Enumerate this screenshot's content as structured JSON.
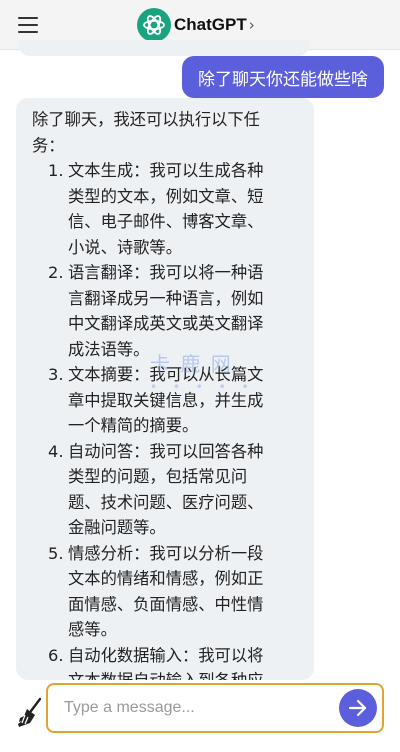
{
  "header": {
    "title": "ChatGPT",
    "title_chevron": "›"
  },
  "conversation": {
    "user_message": "除了聊天你还能做些啥",
    "assistant_message": {
      "intro_lines": [
        "除了聊天，我还可以执行以下任",
        "务："
      ],
      "tasks": [
        {
          "num": "1.",
          "lines": [
            "文本生成：我可以生成各种",
            "类型的文本，例如文章、短",
            "信、电子邮件、博客文章、",
            "小说、诗歌等。"
          ]
        },
        {
          "num": "2.",
          "lines": [
            "语言翻译：我可以将一种语",
            "言翻译成另一种语言，例如",
            "中文翻译成英文或英文翻译",
            "成法语等。"
          ]
        },
        {
          "num": "3.",
          "lines": [
            "文本摘要：我可以从长篇文",
            "章中提取关键信息，并生成",
            "一个精简的摘要。"
          ]
        },
        {
          "num": "4.",
          "lines": [
            "自动问答：我可以回答各种",
            "类型的问题，包括常见问",
            "题、技术问题、医疗问题、",
            "金融问题等。"
          ]
        },
        {
          "num": "5.",
          "lines": [
            "情感分析：我可以分析一段",
            "文本的情绪和情感，例如正",
            "面情感、负面情感、中性情",
            "感等。"
          ]
        },
        {
          "num": "6.",
          "lines": [
            "自动化数据输入：我可以将",
            "文本数据自动输入到各种应"
          ]
        }
      ]
    }
  },
  "watermark": {
    "text": "卡 鹿 网",
    "dots": "• • • • •"
  },
  "composer": {
    "placeholder": "Type a message...",
    "value": ""
  },
  "colors": {
    "accent": "#5b5fdb",
    "input_border": "#e2a431",
    "assistant_bg": "#eef1f4",
    "logo_bg": "#19a37f"
  }
}
